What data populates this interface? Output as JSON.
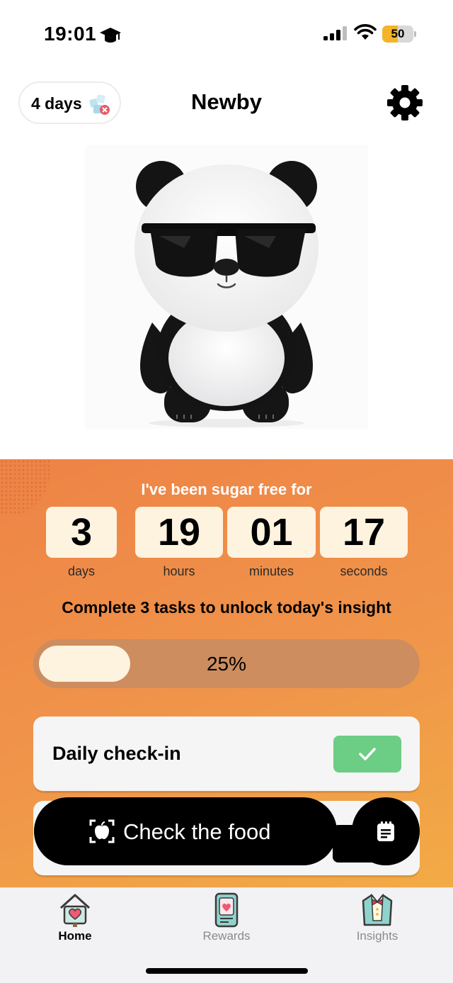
{
  "status_bar": {
    "time": "19:01",
    "battery_level": "50",
    "battery_fraction": 0.5,
    "icons": [
      "graduation-cap-icon",
      "signal-icon",
      "wifi-icon",
      "battery-icon"
    ]
  },
  "header": {
    "streak": "4 days",
    "title": "Newby",
    "settings_icon": "gear-icon"
  },
  "mascot": {
    "description_icon": "panda-with-sunglasses-illustration"
  },
  "tracker": {
    "headline": "I've been sugar free for",
    "counters": [
      {
        "value": "3",
        "unit": "days"
      },
      {
        "value": "19",
        "unit": "hours"
      },
      {
        "value": "01",
        "unit": "minutes"
      },
      {
        "value": "17",
        "unit": "seconds"
      }
    ],
    "tasks_title": "Complete 3 tasks to unlock today's insight",
    "progress_percent": 25,
    "progress_label": "25%",
    "tasks": [
      {
        "label": "Daily check-in",
        "done": true,
        "check_icon": "checkmark-icon"
      }
    ]
  },
  "actions": {
    "check_food_label": "Check the food",
    "check_food_icon": "scan-apple-icon",
    "journal_icon": "notepad-icon"
  },
  "tab_bar": {
    "tabs": [
      {
        "label": "Home",
        "icon": "house-heart-icon",
        "active": true
      },
      {
        "label": "Rewards",
        "icon": "heart-card-icon",
        "active": false
      },
      {
        "label": "Insights",
        "icon": "tuxedo-icon",
        "active": false
      }
    ]
  },
  "colors": {
    "panel_start": "#ee8346",
    "panel_end": "#f2ab45",
    "counter_bg": "#fdf3df",
    "check_green": "#6ccd84"
  }
}
